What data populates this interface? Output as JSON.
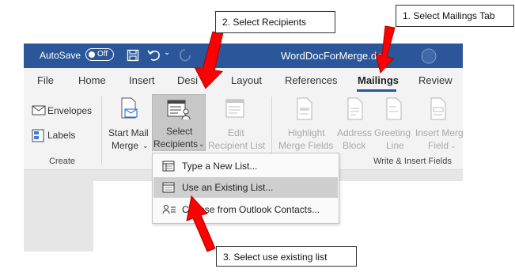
{
  "titlebar": {
    "autosave_label": "AutoSave",
    "toggle_state": "Off",
    "doc_title": "WordDocForMerge.do"
  },
  "tabs": [
    "File",
    "Home",
    "Insert",
    "Desi",
    "Layout",
    "References",
    "Mailings",
    "Review"
  ],
  "ribbon": {
    "envelopes": "Envelopes",
    "labels": "Labels",
    "create_group": "Create",
    "start_mail_merge_1": "Start Mail",
    "start_mail_merge_2": "Merge",
    "select_recipients_1": "Select",
    "select_recipients_2": "Recipients",
    "edit_recipient_1": "Edit",
    "edit_recipient_2": "Recipient List",
    "highlight_1": "Highlight",
    "highlight_2": "Merge Fields",
    "address_1": "Address",
    "address_2": "Block",
    "greeting_1": "Greeting",
    "greeting_2": "Line",
    "insert_merge_1": "Insert Merge",
    "insert_merge_2": "Field",
    "write_insert_group": "Write & Insert Fields"
  },
  "menu": {
    "type_new_list": "Type a New List...",
    "use_existing_list": "Use an Existing List...",
    "choose_outlook": "Choose from Outlook Contacts..."
  },
  "callouts": {
    "step1": "1. Select Mailings Tab",
    "step2": "2. Select Recipients",
    "step3": "3. Select use existing list"
  },
  "colors": {
    "titlebar": "#2b579a",
    "arrow": "#ff0000",
    "ribbon": "#f3f3f3",
    "highlight": "#c7c7c7"
  }
}
